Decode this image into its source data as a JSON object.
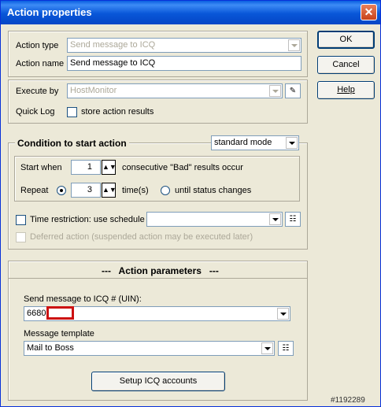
{
  "window": {
    "title": "Action properties",
    "close_glyph": "✕"
  },
  "buttons": {
    "ok": "OK",
    "cancel": "Cancel",
    "help": "Help",
    "setup_icq": "Setup ICQ accounts"
  },
  "general": {
    "action_type_label": "Action type",
    "action_type_value": "Send message to ICQ",
    "action_name_label": "Action name",
    "action_name_value": "Send message to ICQ",
    "execute_by_label": "Execute by",
    "execute_by_value": "HostMonitor",
    "quick_log_label": "Quick Log",
    "store_results_label": "store action results"
  },
  "condition": {
    "title": "Condition to start action",
    "mode_value": "standard mode",
    "start_when_label": "Start when",
    "start_when_value": "1",
    "bad_results_label": "consecutive \"Bad\" results occur",
    "repeat_label": "Repeat",
    "repeat_value": "3",
    "times_label": "time(s)",
    "until_label": "until status changes",
    "time_restriction_label": "Time restriction: use schedule",
    "schedule_value": "",
    "deferred_label": "Deferred action (suspended action may be executed later)"
  },
  "params": {
    "title": "---   Action parameters   ---",
    "uin_label": "Send message to ICQ # (UIN):",
    "uin_value": "6680",
    "template_label": "Message template",
    "template_value": "Mail to Boss"
  },
  "watermark": "#1192289",
  "icons": [
    "close-icon",
    "pen-eraser-icon",
    "schedule-list-icon",
    "template-list-icon",
    "spin-updown-icon"
  ]
}
